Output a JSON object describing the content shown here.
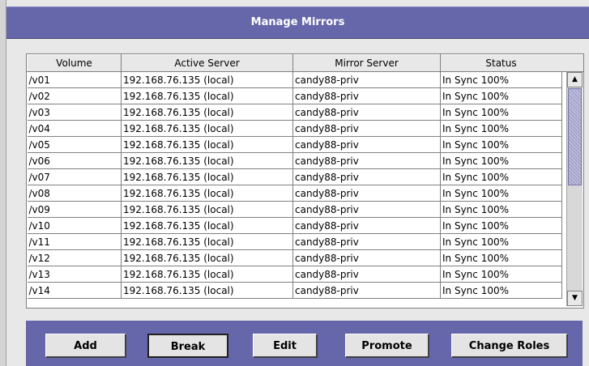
{
  "title": "Manage Mirrors",
  "table": {
    "columns": [
      "Volume",
      "Active Server",
      "Mirror Server",
      "Status"
    ],
    "rows": [
      [
        "/v01",
        "192.168.76.135 (local)",
        "candy88-priv",
        "In Sync 100%"
      ],
      [
        "/v02",
        "192.168.76.135 (local)",
        "candy88-priv",
        "In Sync 100%"
      ],
      [
        "/v03",
        "192.168.76.135 (local)",
        "candy88-priv",
        "In Sync 100%"
      ],
      [
        "/v04",
        "192.168.76.135 (local)",
        "candy88-priv",
        "In Sync 100%"
      ],
      [
        "/v05",
        "192.168.76.135 (local)",
        "candy88-priv",
        "In Sync 100%"
      ],
      [
        "/v06",
        "192.168.76.135 (local)",
        "candy88-priv",
        "In Sync 100%"
      ],
      [
        "/v07",
        "192.168.76.135 (local)",
        "candy88-priv",
        "In Sync 100%"
      ],
      [
        "/v08",
        "192.168.76.135 (local)",
        "candy88-priv",
        "In Sync 100%"
      ],
      [
        "/v09",
        "192.168.76.135 (local)",
        "candy88-priv",
        "In Sync 100%"
      ],
      [
        "/v10",
        "192.168.76.135 (local)",
        "candy88-priv",
        "In Sync 100%"
      ],
      [
        "/v11",
        "192.168.76.135 (local)",
        "candy88-priv",
        "In Sync 100%"
      ],
      [
        "/v12",
        "192.168.76.135 (local)",
        "candy88-priv",
        "In Sync 100%"
      ],
      [
        "/v13",
        "192.168.76.135 (local)",
        "candy88-priv",
        "In Sync 100%"
      ],
      [
        "/v14",
        "192.168.76.135 (local)",
        "candy88-priv",
        "In Sync 100%"
      ]
    ]
  },
  "scrollbar": {
    "up_icon": "arrow-up-icon",
    "down_icon": "arrow-down-icon"
  },
  "buttons": {
    "add": "Add",
    "break": "Break",
    "edit": "Edit",
    "promote": "Promote",
    "change_roles": "Change Roles"
  },
  "colors": {
    "accent": "#6666aa",
    "panel": "#e8e8e8",
    "table_bg": "#ffffff"
  }
}
